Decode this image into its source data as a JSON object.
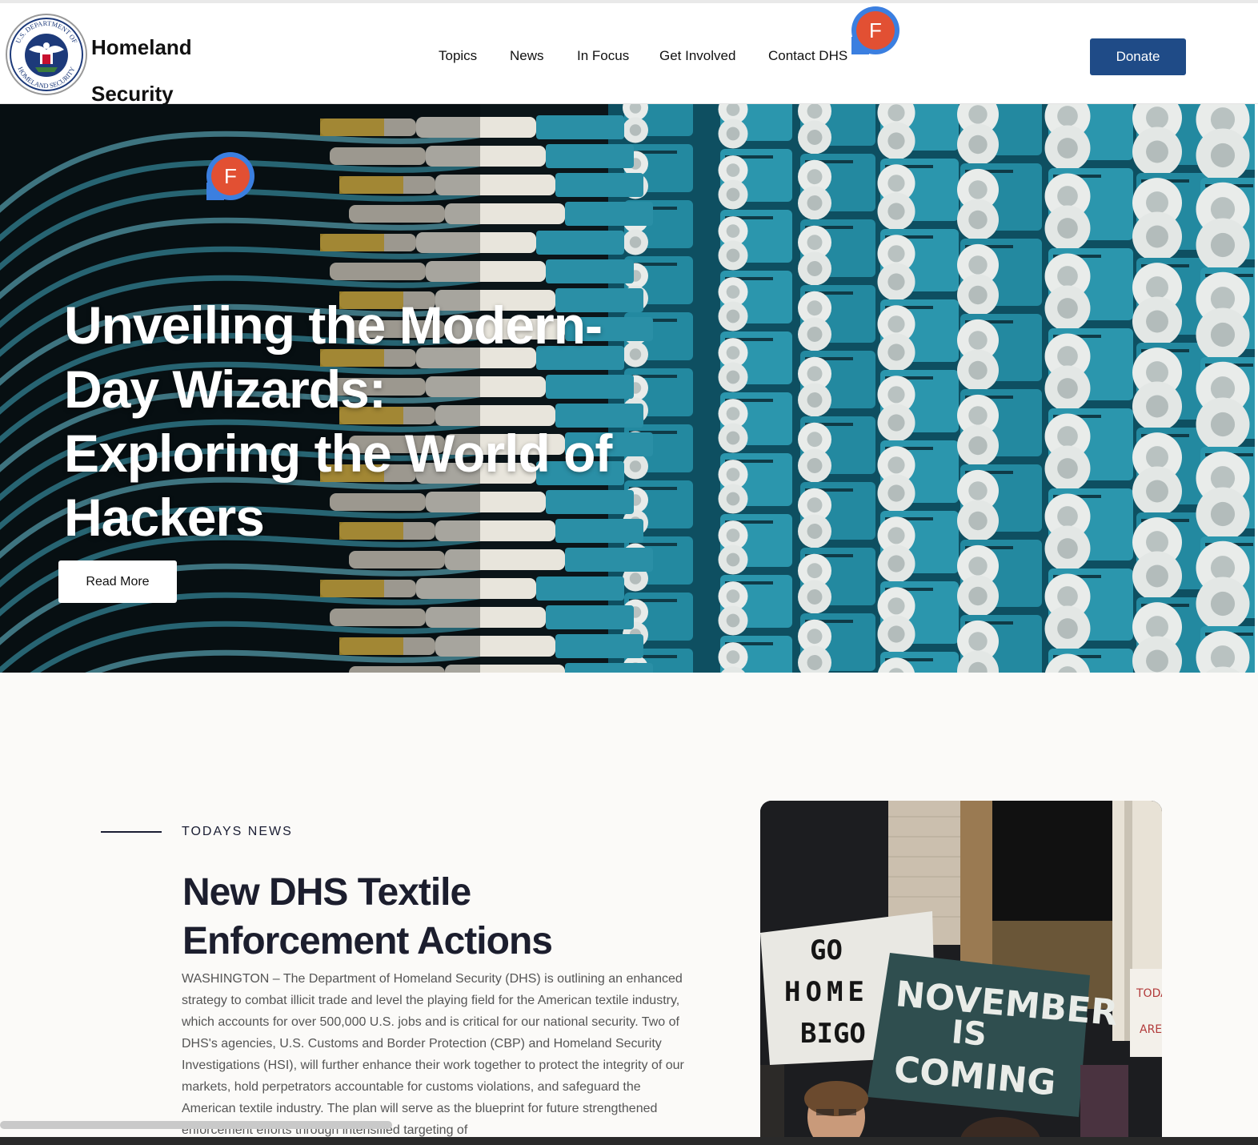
{
  "header": {
    "brand_line1": "Homeland",
    "brand_line2": "Security",
    "seal_text_top": "U.S. DEPARTMENT OF",
    "seal_text_bottom": "HOMELAND SECURITY",
    "nav": [
      "Topics",
      "News",
      "In Focus",
      "Get Involved",
      "Contact DHS"
    ],
    "donate_label": "Donate"
  },
  "extension_badge": {
    "letter": "F",
    "color": "#e25033",
    "ring_color": "#3b7fe0"
  },
  "hero": {
    "title": "Unveiling the Modern-Day Wizards: Exploring the World of Hackers",
    "button_label": "Read More"
  },
  "news": {
    "eyebrow": "TODAYS NEWS",
    "title": "New DHS Textile Enforcement Actions",
    "body": "WASHINGTON – The Department of Homeland Security (DHS) is outlining an enhanced strategy to combat illicit trade and level the playing field for the American textile industry, which accounts for over 500,000 U.S. jobs and is critical for our national security. Two of DHS's agencies, U.S. Customs and Border Protection (CBP) and Homeland Security Investigations (HSI), will further enhance their work together to protect the integrity of our markets, hold perpetrators accountable for customs violations, and safeguard the American textile industry. The plan will serve as the blueprint for future strengthened enforcement efforts through intensified targeting of",
    "image_signs": {
      "sign1": [
        "GO",
        "HOME",
        "BIGO"
      ],
      "sign2": [
        "NOVEMBER",
        "IS",
        "COMING"
      ],
      "sign3": [
        "TODAY",
        "ARE"
      ]
    }
  },
  "colors": {
    "donate": "#1f4b87",
    "hero_cable": "#2a8fa6",
    "news_text": "#1c1e2e"
  }
}
